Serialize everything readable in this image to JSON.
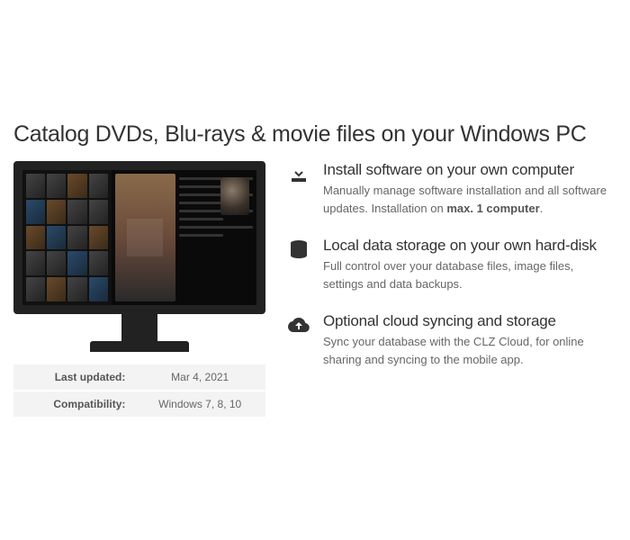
{
  "heading": "Catalog DVDs, Blu-rays & movie files on your Windows PC",
  "info": {
    "last_updated_label": "Last updated:",
    "last_updated_value": "Mar 4, 2021",
    "compatibility_label": "Compatibility:",
    "compatibility_value": "Windows 7, 8, 10"
  },
  "features": [
    {
      "title": "Install software on your own computer",
      "desc_pre": "Manually manage software installation and all software updates. Installation on ",
      "desc_strong": "max. 1 computer",
      "desc_post": "."
    },
    {
      "title": "Local data storage on your own hard-disk",
      "desc_pre": "Full control over your database files, image files, settings and data backups.",
      "desc_strong": "",
      "desc_post": ""
    },
    {
      "title": "Optional cloud syncing and storage",
      "desc_pre": "Sync your database with the CLZ Cloud, for online sharing and syncing to the mobile app.",
      "desc_strong": "",
      "desc_post": ""
    }
  ]
}
